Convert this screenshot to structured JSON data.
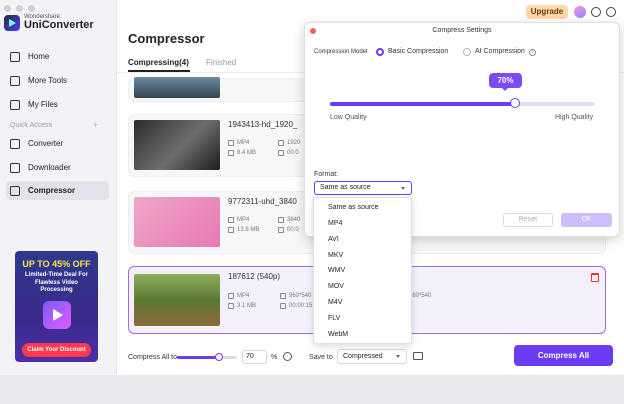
{
  "app": {
    "brand": "Wondershare",
    "name": "UniConverter"
  },
  "sidebar": {
    "items": [
      {
        "label": "Home"
      },
      {
        "label": "More Tools"
      },
      {
        "label": "My Files"
      },
      {
        "label": "Converter"
      },
      {
        "label": "Downloader"
      },
      {
        "label": "Compressor"
      }
    ],
    "quick_access": "Quick Access",
    "promo": {
      "title": "UP TO 45% OFF",
      "subtitle": "Limited-Time Deal For Flawless Video Processing",
      "button": "Claim Your Discount"
    }
  },
  "topbar": {
    "upgrade": "Upgrade"
  },
  "main": {
    "title": "Compressor",
    "tabs": [
      {
        "label": "Compressing(4)"
      },
      {
        "label": "Finished"
      }
    ],
    "files": [
      {
        "name": "1943413-hd_1920_",
        "format": "MP4",
        "size": "8.4 MB",
        "res": "1920",
        "dur": "00:0"
      },
      {
        "name": "9772311-uhd_3840",
        "format": "MP4",
        "size": "13.8 MB",
        "res": "3840",
        "dur": "00:0"
      },
      {
        "name": "187612 (540p)",
        "format": "MP4",
        "size": "3.1 MB",
        "res": "960*540",
        "dur": "00:00:15",
        "res_out": "960*540"
      }
    ]
  },
  "bottom": {
    "compress_all_to": "Compress All to",
    "percent_value": "70",
    "percent_symbol": "%",
    "compress_level": 0.7,
    "save_to": "Save to",
    "save_value": "Compressed",
    "compress_all": "Compress All"
  },
  "dialog": {
    "title": "Compress Settings",
    "model_label": "Compression Model",
    "basic": "Basic Compression",
    "ai": "AI Compression",
    "percent": "70%",
    "quality": 0.7,
    "low": "Low Quality",
    "high": "High Quality",
    "format_label": "Format:",
    "format_value": "Same as source",
    "reset": "Reset",
    "ok": "OK"
  },
  "dropdown": {
    "options": [
      "Same as source",
      "MP4",
      "AVI",
      "MKV",
      "WMV",
      "MOV",
      "M4V",
      "FLV",
      "WebM"
    ]
  },
  "colors": {
    "accent": "#6b3cf4",
    "danger": "#e4342f"
  }
}
